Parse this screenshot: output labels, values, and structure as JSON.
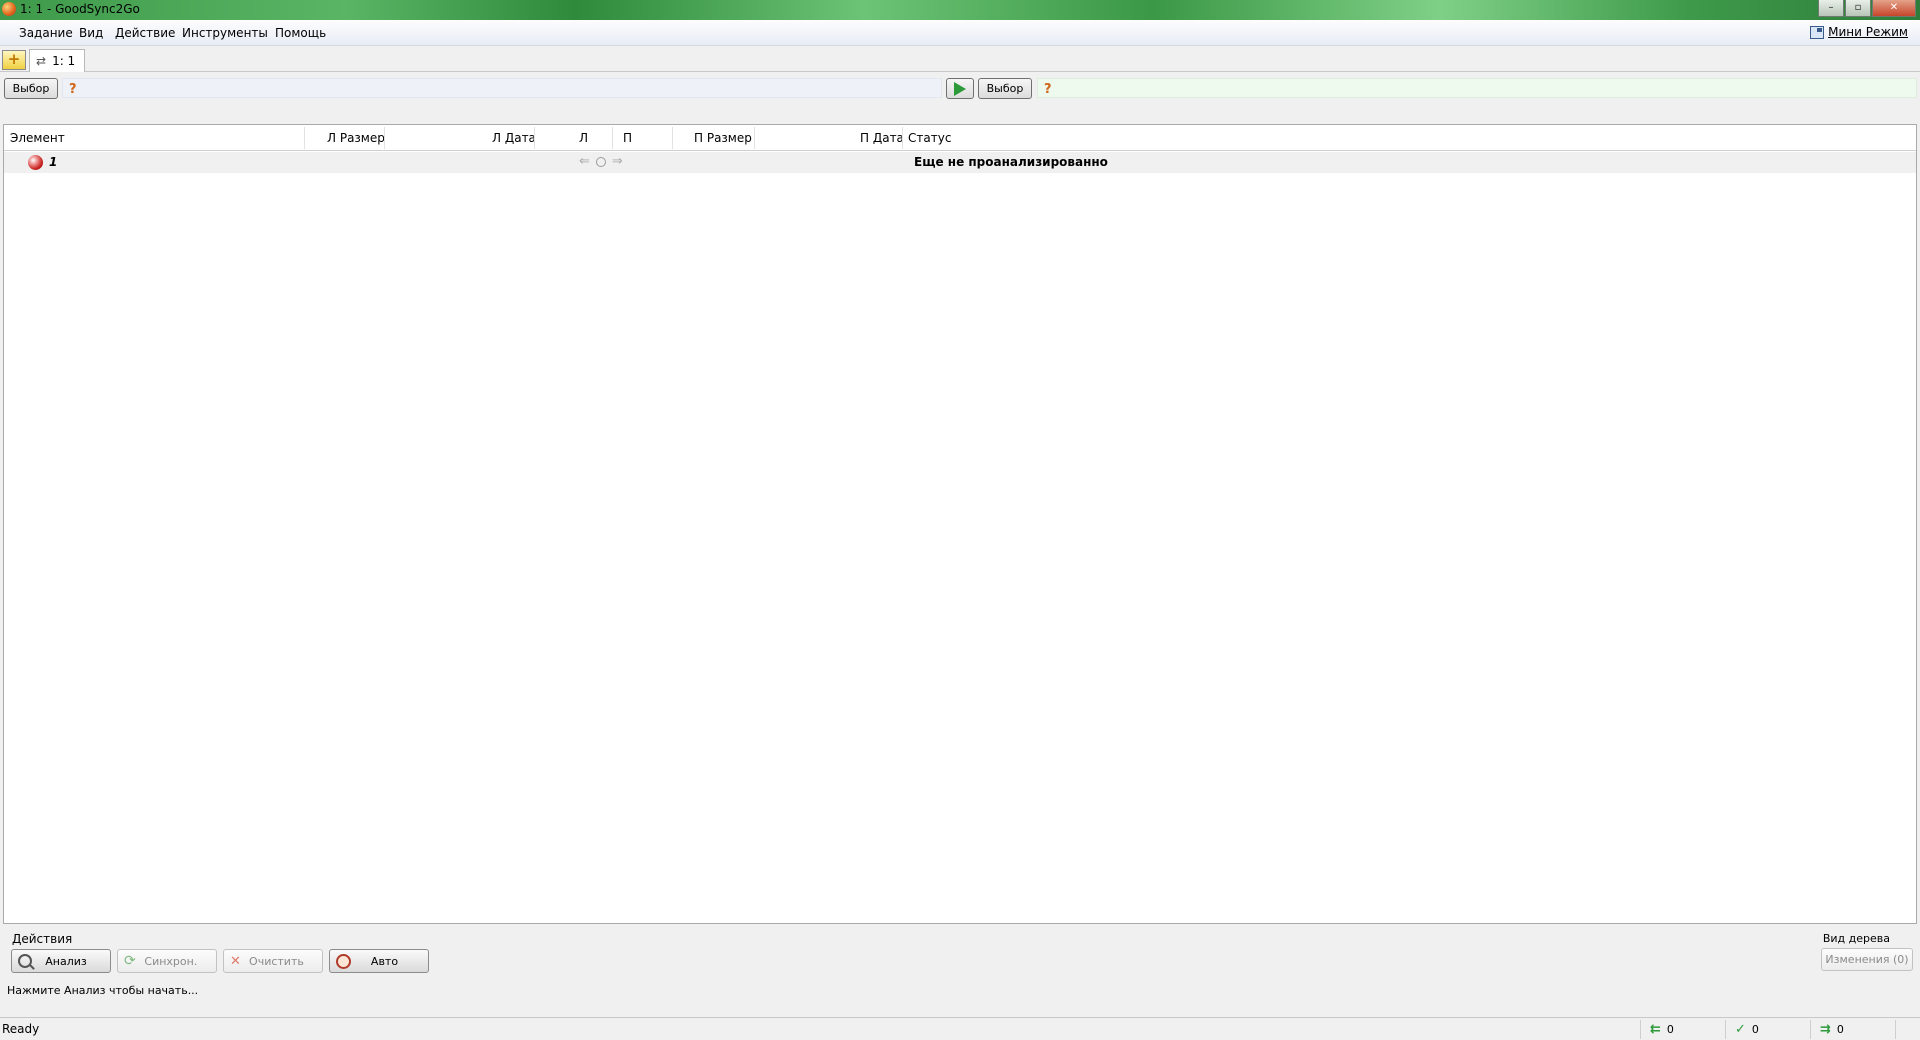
{
  "window": {
    "title": "1: 1 - GoodSync2Go"
  },
  "menu": {
    "items": [
      "Задание",
      "Вид",
      "Действие",
      "Инструменты",
      "Помощь"
    ],
    "mini_mode": "Мини Режим"
  },
  "tabs": {
    "job_tab": "1: 1"
  },
  "paths": {
    "left_button": "Выбор",
    "right_button": "Выбор",
    "unknown_mark": "?"
  },
  "grid": {
    "columns": [
      "Элемент",
      "Л Размер",
      "Л Дата",
      "Л",
      "П",
      "П Размер",
      "П Дата",
      "Статус"
    ],
    "rows": [
      {
        "name": "1",
        "status": "Еще не проанализированно"
      }
    ]
  },
  "actions": {
    "label": "Действия",
    "analyze": "Анализ",
    "sync": "Синхрон.",
    "clean": "Очистить",
    "auto": "Авто",
    "hint": "Нажмите Анализ чтобы начать..."
  },
  "tree_view": {
    "label": "Вид дерева",
    "changes_button": "Изменения (0)"
  },
  "status": {
    "text": "Ready",
    "left_count": "0",
    "check_count": "0",
    "right_count": "0"
  }
}
